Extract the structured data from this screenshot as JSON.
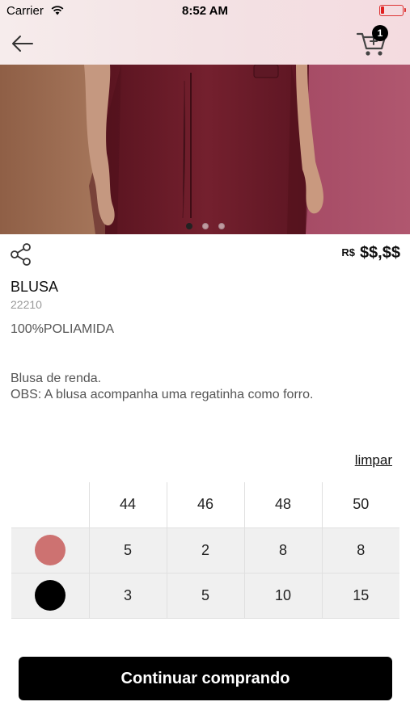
{
  "status_bar": {
    "carrier": "Carrier",
    "time": "8:52 AM"
  },
  "nav": {
    "cart_count": "1"
  },
  "carousel": {
    "slides": 3,
    "active": 0
  },
  "product": {
    "price_currency": "R$",
    "price": "$$,$$",
    "name": "BLUSA",
    "code": "22210",
    "material": "100%POLIAMIDA",
    "description_line1": "Blusa de renda.",
    "description_line2": "OBS: A blusa acompanha uma regatinha como forro."
  },
  "grid": {
    "clear_label": "limpar",
    "sizes": [
      "44",
      "46",
      "48",
      "50"
    ],
    "rows": [
      {
        "color": "#cd7271",
        "quantities": [
          "5",
          "2",
          "8",
          "8"
        ]
      },
      {
        "color": "#000000",
        "quantities": [
          "3",
          "5",
          "10",
          "15"
        ]
      }
    ]
  },
  "cta": {
    "label": "Continuar comprando"
  },
  "colors": {
    "accent": "#000000",
    "battery": "#e02020",
    "hero_fabric": "#6e1b2a",
    "hero_bg": "#a54a63"
  }
}
